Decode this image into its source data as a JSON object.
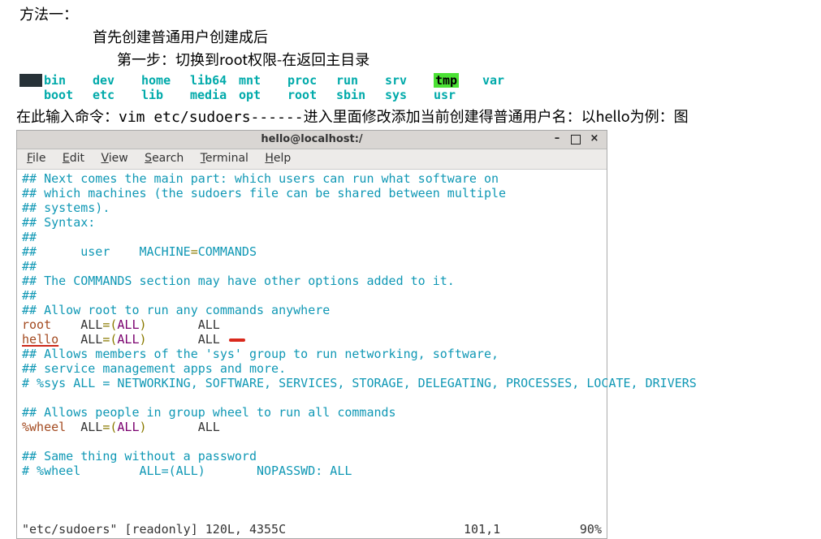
{
  "doc": {
    "line1": "方法一：",
    "line2": "首先创建普通用户创建成后",
    "line3": "第一步：切换到root权限-在返回主目录",
    "cmd_prefix": "在此输入命令：",
    "cmd_code": "vim etc/sudoers------",
    "cmd_suffix": "进入里面修改添加当前创建得普通用户名：以hello为例：图"
  },
  "ls": {
    "row1": [
      "bin",
      "dev",
      "home",
      "lib64",
      "mnt",
      "proc",
      "run",
      "srv",
      "tmp",
      "var"
    ],
    "row2": [
      "boot",
      "etc",
      "lib",
      "media",
      "opt",
      "root",
      "sbin",
      "sys",
      "usr"
    ]
  },
  "terminal": {
    "title": "hello@localhost:/",
    "menu": {
      "file": "File",
      "edit": "Edit",
      "view": "View",
      "search": "Search",
      "terminal": "Terminal",
      "help": "Help"
    },
    "sudoers": {
      "c1": "## Next comes the main part: which users can run what software on",
      "c2": "## which machines (the sudoers file can be shared between multiple",
      "c3": "## systems).",
      "c4": "## Syntax:",
      "c5": "##",
      "c6_a": "##      user    MACHINE",
      "c6_eq": "=",
      "c6_b": "COMMANDS",
      "c7": "##",
      "c8": "## The COMMANDS section may have other options added to it.",
      "c9": "##",
      "c10": "## Allow root to run any commands anywhere",
      "root_user": "root",
      "root_rule_all1": "    ALL",
      "root_eq": "=(",
      "root_mid": "ALL",
      "root_close": ")       ",
      "root_all2": "ALL",
      "hello_user": "hello",
      "hello_rule_all1": "   ALL",
      "hello_eq": "=(",
      "hello_mid": "ALL",
      "hello_close": ")       ",
      "hello_all2": "ALL",
      "c11": "## Allows members of the 'sys' group to run networking, software,",
      "c12": "## service management apps and more.",
      "c13": "# %sys ALL = NETWORKING, SOFTWARE, SERVICES, STORAGE, DELEGATING, PROCESSES, LOCATE, DRIVERS",
      "c14": "## Allows people in group wheel to run all commands",
      "wheel_user": "%wheel",
      "wheel_all1": "  ALL",
      "wheel_eq": "=(",
      "wheel_mid": "ALL",
      "wheel_close": ")       ",
      "wheel_all2": "ALL",
      "c15": "## Same thing without a password",
      "c16": "# %wheel        ALL=(ALL)       NOPASSWD: ALL"
    },
    "status": {
      "left": "\"etc/sudoers\" [readonly] 120L, 4355C",
      "pos": "101,1",
      "pct": "90%"
    }
  }
}
